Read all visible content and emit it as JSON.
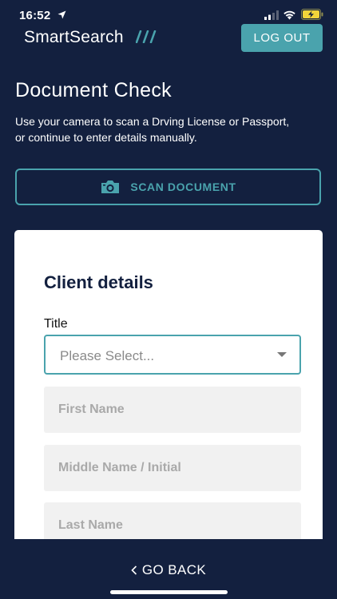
{
  "status_bar": {
    "time": "16:52"
  },
  "header": {
    "logo": "SmartSearch",
    "logout_label": "LOG OUT"
  },
  "page": {
    "title": "Document Check",
    "description": "Use your camera to scan a Drving License or Passport, or continue to enter details manually."
  },
  "scan": {
    "label": "SCAN DOCUMENT"
  },
  "form": {
    "title": "Client details",
    "title_label": "Title",
    "title_placeholder": "Please Select...",
    "first_name_placeholder": "First Name",
    "middle_name_placeholder": "Middle Name / Initial",
    "last_name_placeholder": "Last Name"
  },
  "footer": {
    "back_label": "GO BACK"
  },
  "colors": {
    "background": "#13203f",
    "accent": "#4aa3ad",
    "card": "#ffffff"
  }
}
